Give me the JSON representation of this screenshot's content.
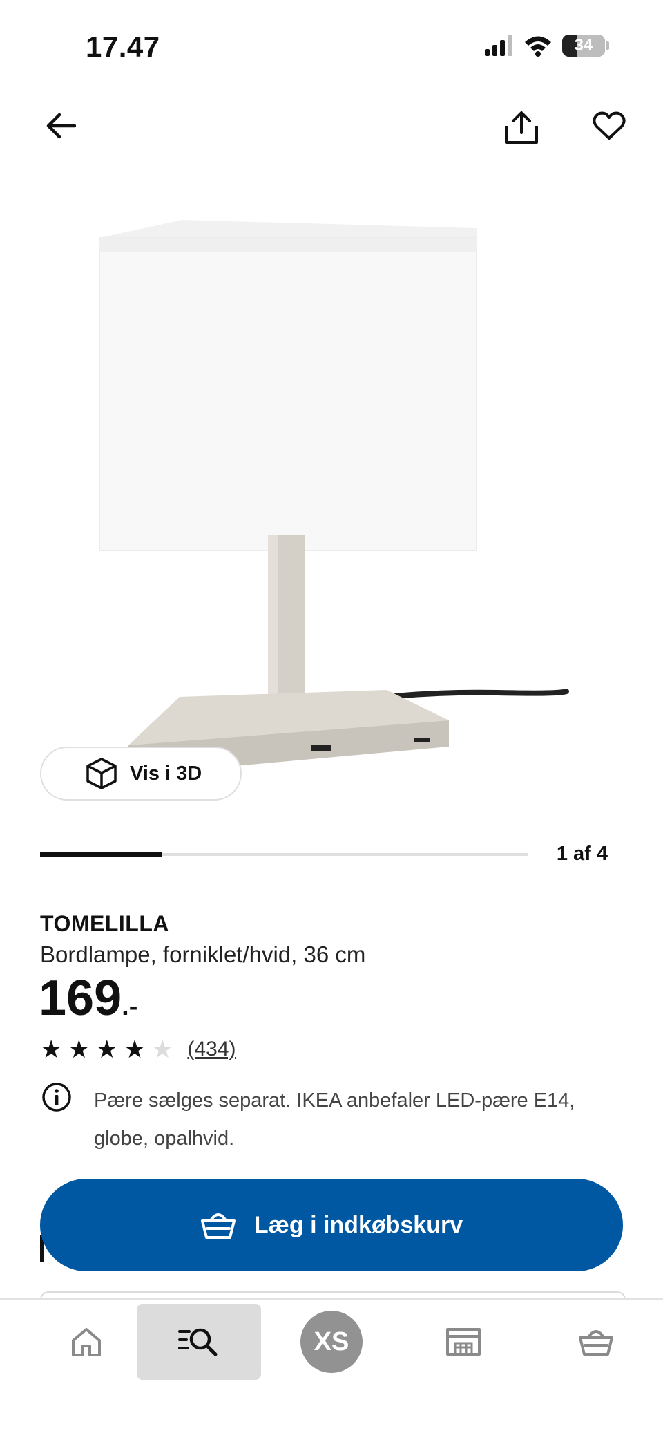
{
  "status_bar": {
    "time": "17.47",
    "battery": "34",
    "battery_level_percent": 34
  },
  "header": {
    "back_icon": "arrow-left-icon",
    "share_icon": "share-icon",
    "favorite_icon": "heart-icon"
  },
  "media": {
    "view_3d_label": "Vis i 3D",
    "pager_label": "1 af 4",
    "pager_progress_fraction": 0.25
  },
  "product": {
    "name": "TOMELILLA",
    "description": "Bordlampe, forniklet/hvid, 36 cm",
    "price": "169",
    "price_suffix": ".-",
    "rating": {
      "stars": 4,
      "max": 5,
      "count_label": "(434)"
    },
    "info_text": "Pære sælges separat. IKEA anbefaler LED-pære E14, globe, opalhvid."
  },
  "actions": {
    "add_to_cart_label": "Læg i indkøbskurv"
  },
  "bottom_nav": {
    "items": [
      "home-icon",
      "search-icon",
      "profile-avatar",
      "store-icon",
      "cart-icon"
    ],
    "profile_initials": "XS"
  },
  "colors": {
    "accent_blue": "#0058a3",
    "text": "#111111",
    "nav_active_bg": "#dcdcdc",
    "avatar_bg": "#929292"
  }
}
